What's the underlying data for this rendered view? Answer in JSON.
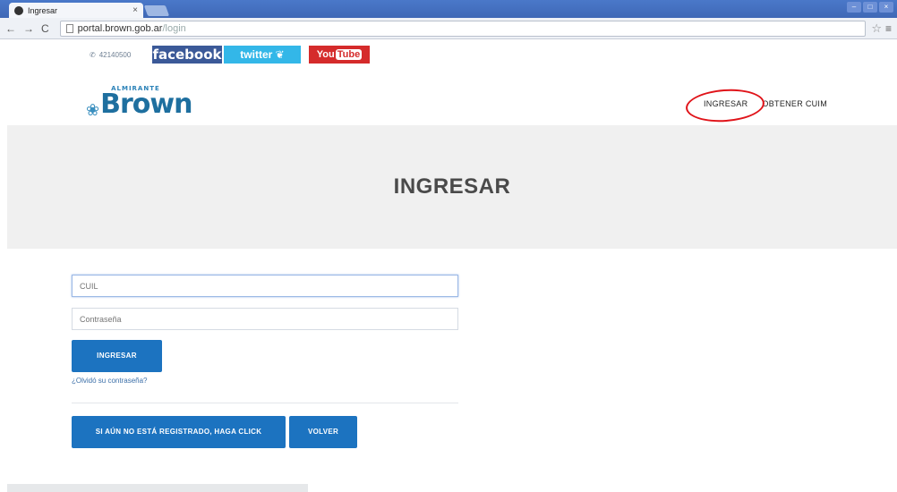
{
  "browser": {
    "tab_title": "Ingresar",
    "tab_close": "×",
    "url_host": "portal.brown.gob.ar",
    "url_path": "/login"
  },
  "social": {
    "phone": "42140500",
    "facebook": "facebook",
    "twitter": "twitter",
    "youtube_you": "You",
    "youtube_tube": "Tube"
  },
  "header": {
    "logo_small": "ALMIRANTE",
    "logo_word": "Brown",
    "nav": [
      "INGRESAR",
      "OBTENER CUIM"
    ]
  },
  "banner": {
    "title": "INGRESAR"
  },
  "form": {
    "cuil_placeholder": "CUIL",
    "password_placeholder": "Contraseña",
    "submit_label": "INGRESAR",
    "forgot_label": "¿Olvidó su contraseña?",
    "register_label": "SI AÚN NO ESTÁ REGISTRADO, HAGA CLICK",
    "back_label": "VOLVER"
  },
  "colors": {
    "primary": "#1c73c0",
    "annotation": "#e0141a"
  }
}
